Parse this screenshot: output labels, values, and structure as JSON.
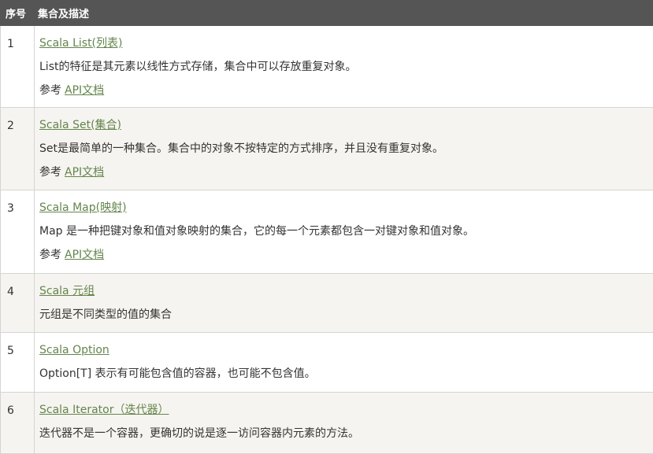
{
  "table": {
    "header": {
      "num": "序号",
      "desc": "集合及描述"
    },
    "rows": [
      {
        "num": "1",
        "title": "Scala List(列表)",
        "description": "List的特征是其元素以线性方式存储，集合中可以存放重复对象。",
        "ref_prefix": "参考",
        "ref_link": "API文档"
      },
      {
        "num": "2",
        "title": "Scala Set(集合)",
        "description": "Set是最简单的一种集合。集合中的对象不按特定的方式排序，并且没有重复对象。",
        "ref_prefix": "参考",
        "ref_link": "API文档"
      },
      {
        "num": "3",
        "title": "Scala Map(映射)",
        "description": "Map 是一种把键对象和值对象映射的集合，它的每一个元素都包含一对键对象和值对象。",
        "ref_prefix": "参考",
        "ref_link": "API文档"
      },
      {
        "num": "4",
        "title": "Scala 元组",
        "description": "元组是不同类型的值的集合"
      },
      {
        "num": "5",
        "title": "Scala Option",
        "description": "Option[T] 表示有可能包含值的容器，也可能不包含值。"
      },
      {
        "num": "6",
        "title": "Scala Iterator（迭代器）",
        "description": "迭代器不是一个容器，更确切的说是逐一访问容器内元素的方法。"
      }
    ]
  },
  "colors": {
    "header_bg": "#555555",
    "header_text": "#ffffff",
    "link": "#64854c",
    "row_alt_bg": "#f6f4f0",
    "border": "#d4d4d4"
  }
}
